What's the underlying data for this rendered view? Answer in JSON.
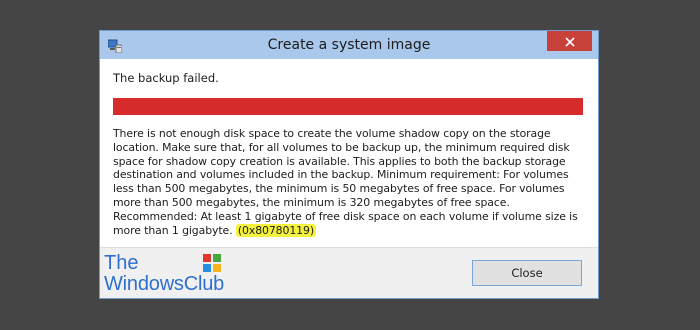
{
  "window": {
    "title": "Create a system image",
    "icon": "system-image-app-icon",
    "close_icon": "close-icon"
  },
  "content": {
    "heading": "The backup failed.",
    "progress_value": 1.0,
    "progress_color": "#d72a2a",
    "message": "There is not enough disk space to create the volume shadow copy on the storage location. Make sure that, for all volumes to be backup up, the minimum required disk space for shadow copy creation is available. This applies to both the backup storage destination and volumes included in the backup. Minimum requirement: For volumes less than 500 megabytes, the minimum is 50 megabytes of free space. For volumes more than 500 megabytes, the minimum is 320 megabytes of free space.  Recommended: At least 1 gigabyte of free disk space on each volume if volume size is more than 1 gigabyte.",
    "error_code": "(0x80780119)",
    "highlight_color": "#f4f23c"
  },
  "footer": {
    "close_label": "Close"
  },
  "watermark": {
    "line1": "The",
    "line2": "WindowsClub",
    "logo": "windows-logo-icon"
  }
}
